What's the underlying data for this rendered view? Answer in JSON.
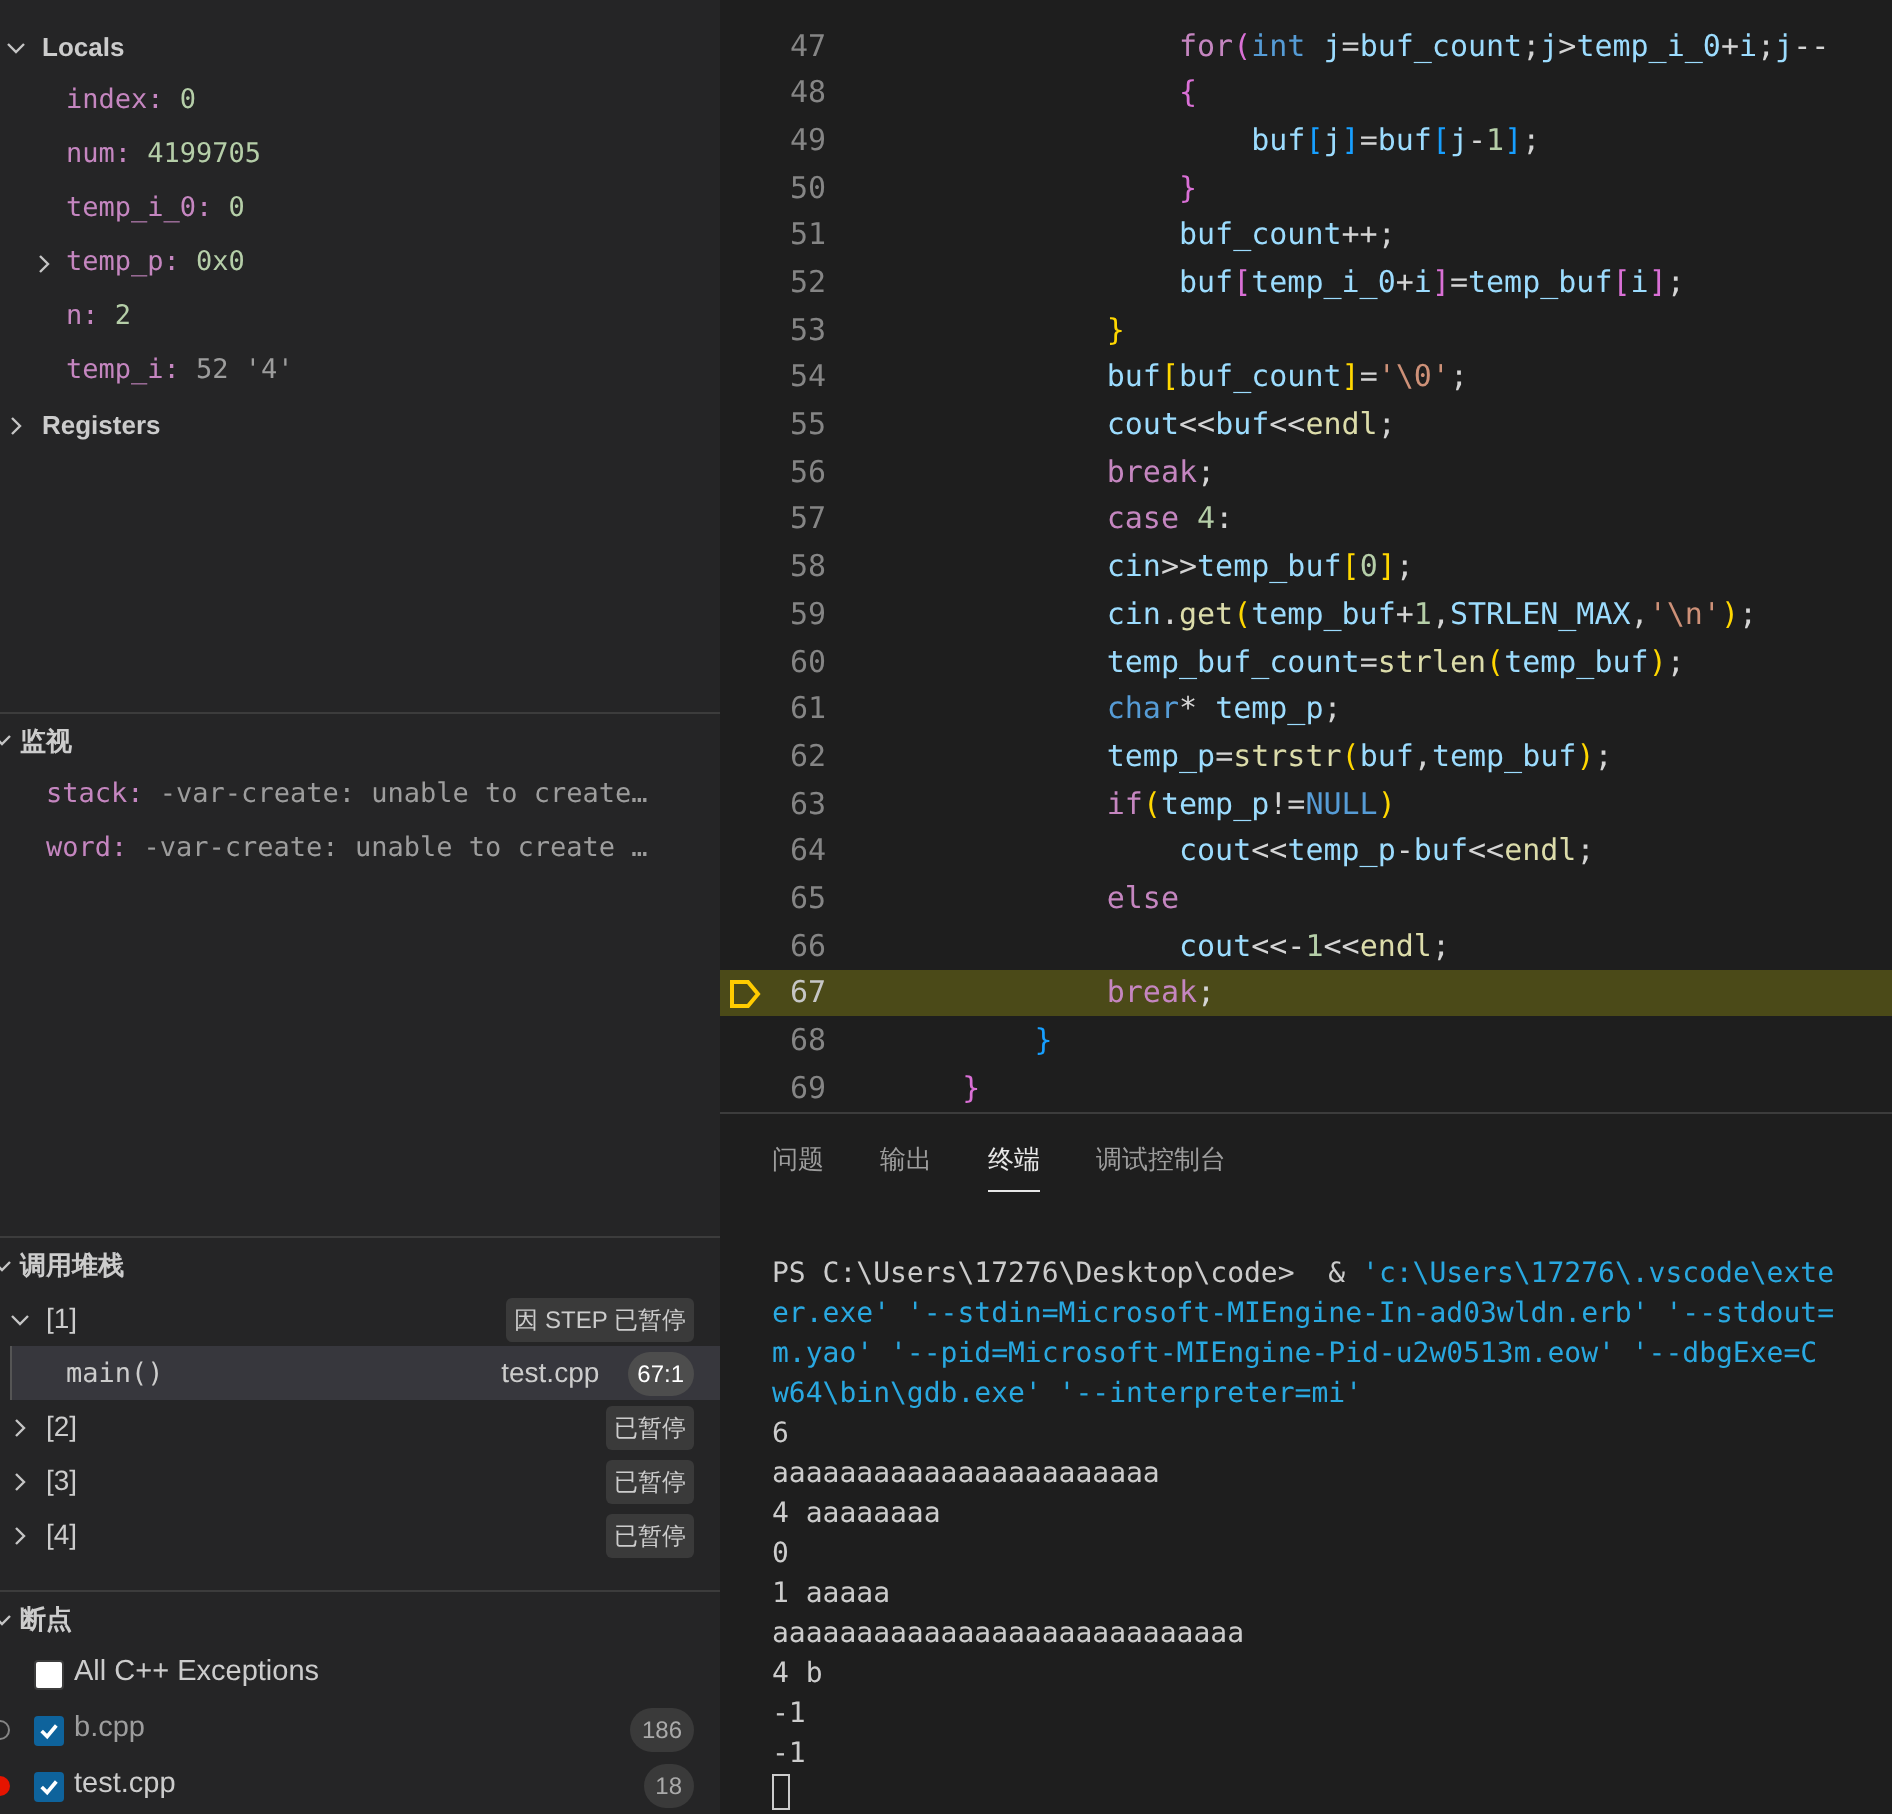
{
  "variables": {
    "scopes": [
      {
        "label": "Locals",
        "expanded": true,
        "items": [
          {
            "name": "index:",
            "value": "0",
            "kind": "number",
            "expandable": false
          },
          {
            "name": "num:",
            "value": "4199705",
            "kind": "number",
            "expandable": false
          },
          {
            "name": "temp_i_0:",
            "value": "0",
            "kind": "number",
            "expandable": false
          },
          {
            "name": "temp_p:",
            "value": "0x0",
            "kind": "number",
            "expandable": true
          },
          {
            "name": "n:",
            "value": "2",
            "kind": "number",
            "expandable": false
          },
          {
            "name": "temp_i:",
            "value": "52 '4'",
            "kind": "char",
            "expandable": false
          }
        ]
      },
      {
        "label": "Registers",
        "expanded": false
      }
    ]
  },
  "watch": {
    "title": "监视",
    "expanded": true,
    "items": [
      {
        "name": "stack:",
        "value": "-var-create: unable to create…"
      },
      {
        "name": "word:",
        "value": "-var-create: unable to create …"
      }
    ]
  },
  "call_stack": {
    "title": "调用堆栈",
    "expanded": true,
    "threads": [
      {
        "label": "[1]",
        "status": "因 STEP 已暂停",
        "expanded": true,
        "frames": [
          {
            "name": "main()",
            "file": "test.cpp",
            "position": "67:1",
            "selected": true
          }
        ]
      },
      {
        "label": "[2]",
        "status": "已暂停",
        "expanded": false
      },
      {
        "label": "[3]",
        "status": "已暂停",
        "expanded": false
      },
      {
        "label": "[4]",
        "status": "已暂停",
        "expanded": false
      }
    ]
  },
  "breakpoints": {
    "title": "断点",
    "expanded": true,
    "items": [
      {
        "kind": "exception",
        "label": "All C++ Exceptions",
        "checked": false
      },
      {
        "kind": "file",
        "label": "b.cpp",
        "checked": true,
        "verified": false,
        "line": "186"
      },
      {
        "kind": "file",
        "label": "test.cpp",
        "checked": true,
        "verified": true,
        "line": "18"
      }
    ]
  },
  "editor": {
    "lines": [
      {
        "number": "47",
        "current": false,
        "tokens": [
          {
            "kind": "control",
            "text": "                for"
          },
          {
            "kind": "bracket2",
            "text": "("
          },
          {
            "kind": "keyword",
            "text": "int"
          },
          {
            "kind": "variable",
            "text": " j"
          },
          {
            "kind": "plain",
            "text": "="
          },
          {
            "kind": "variable",
            "text": "buf_count"
          },
          {
            "kind": "plain",
            "text": ";"
          },
          {
            "kind": "variable",
            "text": "j"
          },
          {
            "kind": "plain",
            "text": ">"
          },
          {
            "kind": "variable",
            "text": "temp_i_0"
          },
          {
            "kind": "plain",
            "text": "+"
          },
          {
            "kind": "variable",
            "text": "i"
          },
          {
            "kind": "plain",
            "text": ";"
          },
          {
            "kind": "variable",
            "text": "j"
          },
          {
            "kind": "plain",
            "text": "--"
          }
        ]
      },
      {
        "number": "48",
        "current": false,
        "tokens": [
          {
            "kind": "bracket2",
            "text": "                {"
          }
        ]
      },
      {
        "number": "49",
        "current": false,
        "tokens": [
          {
            "kind": "variable",
            "text": "                    buf"
          },
          {
            "kind": "bracket3",
            "text": "["
          },
          {
            "kind": "variable",
            "text": "j"
          },
          {
            "kind": "bracket3",
            "text": "]"
          },
          {
            "kind": "plain",
            "text": "="
          },
          {
            "kind": "variable",
            "text": "buf"
          },
          {
            "kind": "bracket3",
            "text": "["
          },
          {
            "kind": "variable",
            "text": "j"
          },
          {
            "kind": "plain",
            "text": "-"
          },
          {
            "kind": "number",
            "text": "1"
          },
          {
            "kind": "bracket3",
            "text": "]"
          },
          {
            "kind": "plain",
            "text": ";"
          }
        ]
      },
      {
        "number": "50",
        "current": false,
        "tokens": [
          {
            "kind": "bracket2",
            "text": "                }"
          }
        ]
      },
      {
        "number": "51",
        "current": false,
        "tokens": [
          {
            "kind": "variable",
            "text": "                buf_count"
          },
          {
            "kind": "plain",
            "text": "++;"
          }
        ]
      },
      {
        "number": "52",
        "current": false,
        "tokens": [
          {
            "kind": "variable",
            "text": "                buf"
          },
          {
            "kind": "bracket2",
            "text": "["
          },
          {
            "kind": "variable",
            "text": "temp_i_0"
          },
          {
            "kind": "plain",
            "text": "+"
          },
          {
            "kind": "variable",
            "text": "i"
          },
          {
            "kind": "bracket2",
            "text": "]"
          },
          {
            "kind": "plain",
            "text": "="
          },
          {
            "kind": "variable",
            "text": "temp_buf"
          },
          {
            "kind": "bracket2",
            "text": "["
          },
          {
            "kind": "variable",
            "text": "i"
          },
          {
            "kind": "bracket2",
            "text": "]"
          },
          {
            "kind": "plain",
            "text": ";"
          }
        ]
      },
      {
        "number": "53",
        "current": false,
        "tokens": [
          {
            "kind": "bracket1",
            "text": "            }"
          }
        ]
      },
      {
        "number": "54",
        "current": false,
        "tokens": [
          {
            "kind": "variable",
            "text": "            buf"
          },
          {
            "kind": "bracket1",
            "text": "["
          },
          {
            "kind": "variable",
            "text": "buf_count"
          },
          {
            "kind": "bracket1",
            "text": "]"
          },
          {
            "kind": "plain",
            "text": "="
          },
          {
            "kind": "string",
            "text": "'\\0'"
          },
          {
            "kind": "plain",
            "text": ";"
          }
        ]
      },
      {
        "number": "55",
        "current": false,
        "tokens": [
          {
            "kind": "variable",
            "text": "            cout"
          },
          {
            "kind": "plain",
            "text": "<<"
          },
          {
            "kind": "variable",
            "text": "buf"
          },
          {
            "kind": "plain",
            "text": "<<"
          },
          {
            "kind": "function",
            "text": "endl"
          },
          {
            "kind": "plain",
            "text": ";"
          }
        ]
      },
      {
        "number": "56",
        "current": false,
        "tokens": [
          {
            "kind": "control",
            "text": "            break"
          },
          {
            "kind": "plain",
            "text": ";"
          }
        ]
      },
      {
        "number": "57",
        "current": false,
        "tokens": [
          {
            "kind": "control",
            "text": "            case"
          },
          {
            "kind": "number",
            "text": " 4"
          },
          {
            "kind": "plain",
            "text": ":"
          }
        ]
      },
      {
        "number": "58",
        "current": false,
        "tokens": [
          {
            "kind": "variable",
            "text": "            cin"
          },
          {
            "kind": "plain",
            "text": ">>"
          },
          {
            "kind": "variable",
            "text": "temp_buf"
          },
          {
            "kind": "bracket1",
            "text": "["
          },
          {
            "kind": "number",
            "text": "0"
          },
          {
            "kind": "bracket1",
            "text": "]"
          },
          {
            "kind": "plain",
            "text": ";"
          }
        ]
      },
      {
        "number": "59",
        "current": false,
        "tokens": [
          {
            "kind": "variable",
            "text": "            cin"
          },
          {
            "kind": "plain",
            "text": "."
          },
          {
            "kind": "function",
            "text": "get"
          },
          {
            "kind": "bracket1",
            "text": "("
          },
          {
            "kind": "variable",
            "text": "temp_buf"
          },
          {
            "kind": "plain",
            "text": "+"
          },
          {
            "kind": "number",
            "text": "1"
          },
          {
            "kind": "plain",
            "text": ","
          },
          {
            "kind": "variable",
            "text": "STRLEN_MAX"
          },
          {
            "kind": "plain",
            "text": ","
          },
          {
            "kind": "string",
            "text": "'\\n'"
          },
          {
            "kind": "bracket1",
            "text": ")"
          },
          {
            "kind": "plain",
            "text": ";"
          }
        ]
      },
      {
        "number": "60",
        "current": false,
        "tokens": [
          {
            "kind": "variable",
            "text": "            temp_buf_count"
          },
          {
            "kind": "plain",
            "text": "="
          },
          {
            "kind": "function",
            "text": "strlen"
          },
          {
            "kind": "bracket1",
            "text": "("
          },
          {
            "kind": "variable",
            "text": "temp_buf"
          },
          {
            "kind": "bracket1",
            "text": ")"
          },
          {
            "kind": "plain",
            "text": ";"
          }
        ]
      },
      {
        "number": "61",
        "current": false,
        "tokens": [
          {
            "kind": "keyword",
            "text": "            char"
          },
          {
            "kind": "plain",
            "text": "* "
          },
          {
            "kind": "variable",
            "text": "temp_p"
          },
          {
            "kind": "plain",
            "text": ";"
          }
        ]
      },
      {
        "number": "62",
        "current": false,
        "tokens": [
          {
            "kind": "variable",
            "text": "            temp_p"
          },
          {
            "kind": "plain",
            "text": "="
          },
          {
            "kind": "function",
            "text": "strstr"
          },
          {
            "kind": "bracket1",
            "text": "("
          },
          {
            "kind": "variable",
            "text": "buf"
          },
          {
            "kind": "plain",
            "text": ","
          },
          {
            "kind": "variable",
            "text": "temp_buf"
          },
          {
            "kind": "bracket1",
            "text": ")"
          },
          {
            "kind": "plain",
            "text": ";"
          }
        ]
      },
      {
        "number": "63",
        "current": false,
        "tokens": [
          {
            "kind": "control",
            "text": "            if"
          },
          {
            "kind": "bracket1",
            "text": "("
          },
          {
            "kind": "variable",
            "text": "temp_p"
          },
          {
            "kind": "plain",
            "text": "!="
          },
          {
            "kind": "keyword",
            "text": "NULL"
          },
          {
            "kind": "bracket1",
            "text": ")"
          }
        ]
      },
      {
        "number": "64",
        "current": false,
        "tokens": [
          {
            "kind": "variable",
            "text": "                cout"
          },
          {
            "kind": "plain",
            "text": "<<"
          },
          {
            "kind": "variable",
            "text": "temp_p"
          },
          {
            "kind": "plain",
            "text": "-"
          },
          {
            "kind": "variable",
            "text": "buf"
          },
          {
            "kind": "plain",
            "text": "<<"
          },
          {
            "kind": "function",
            "text": "endl"
          },
          {
            "kind": "plain",
            "text": ";"
          }
        ]
      },
      {
        "number": "65",
        "current": false,
        "tokens": [
          {
            "kind": "control",
            "text": "            else"
          }
        ]
      },
      {
        "number": "66",
        "current": false,
        "tokens": [
          {
            "kind": "variable",
            "text": "                cout"
          },
          {
            "kind": "plain",
            "text": "<<-"
          },
          {
            "kind": "number",
            "text": "1"
          },
          {
            "kind": "plain",
            "text": "<<"
          },
          {
            "kind": "function",
            "text": "endl"
          },
          {
            "kind": "plain",
            "text": ";"
          }
        ]
      },
      {
        "number": "67",
        "current": true,
        "tokens": [
          {
            "kind": "control",
            "text": "            break"
          },
          {
            "kind": "plain",
            "text": ";"
          }
        ]
      },
      {
        "number": "68",
        "current": false,
        "tokens": [
          {
            "kind": "bracket3",
            "text": "        }"
          }
        ]
      },
      {
        "number": "69",
        "current": false,
        "tokens": [
          {
            "kind": "bracket2",
            "text": "    }"
          }
        ]
      }
    ]
  },
  "panel": {
    "tabs": [
      {
        "label": "问题",
        "selected": false
      },
      {
        "label": "输出",
        "selected": false
      },
      {
        "label": "终端",
        "selected": true
      },
      {
        "label": "调试控制台",
        "selected": false
      }
    ],
    "terminal": [
      [
        {
          "kind": "plain",
          "text": "PS C:\\Users\\17276\\Desktop\\code>  & "
        },
        {
          "kind": "string",
          "text": "'c:\\Users\\17276\\.vscode\\exte"
        }
      ],
      [
        {
          "kind": "string",
          "text": "er.exe' '--stdin=Microsoft-MIEngine-In-ad03wldn.erb' '--stdout="
        }
      ],
      [
        {
          "kind": "string",
          "text": "m.yao' '--pid=Microsoft-MIEngine-Pid-u2w0513m.eow' '--dbgExe=C"
        }
      ],
      [
        {
          "kind": "string",
          "text": "w64\\bin\\gdb.exe' '--interpreter=mi'"
        }
      ],
      [
        {
          "kind": "plain",
          "text": "6"
        }
      ],
      [
        {
          "kind": "plain",
          "text": "aaaaaaaaaaaaaaaaaaaaaaa"
        }
      ],
      [
        {
          "kind": "plain",
          "text": "4 aaaaaaaa"
        }
      ],
      [
        {
          "kind": "plain",
          "text": "0"
        }
      ],
      [
        {
          "kind": "plain",
          "text": "1 aaaaa"
        }
      ],
      [
        {
          "kind": "plain",
          "text": "aaaaaaaaaaaaaaaaaaaaaaaaaaaa"
        }
      ],
      [
        {
          "kind": "plain",
          "text": "4 b"
        }
      ],
      [
        {
          "kind": "plain",
          "text": "-1"
        }
      ],
      [
        {
          "kind": "plain",
          "text": "-1"
        }
      ]
    ]
  }
}
